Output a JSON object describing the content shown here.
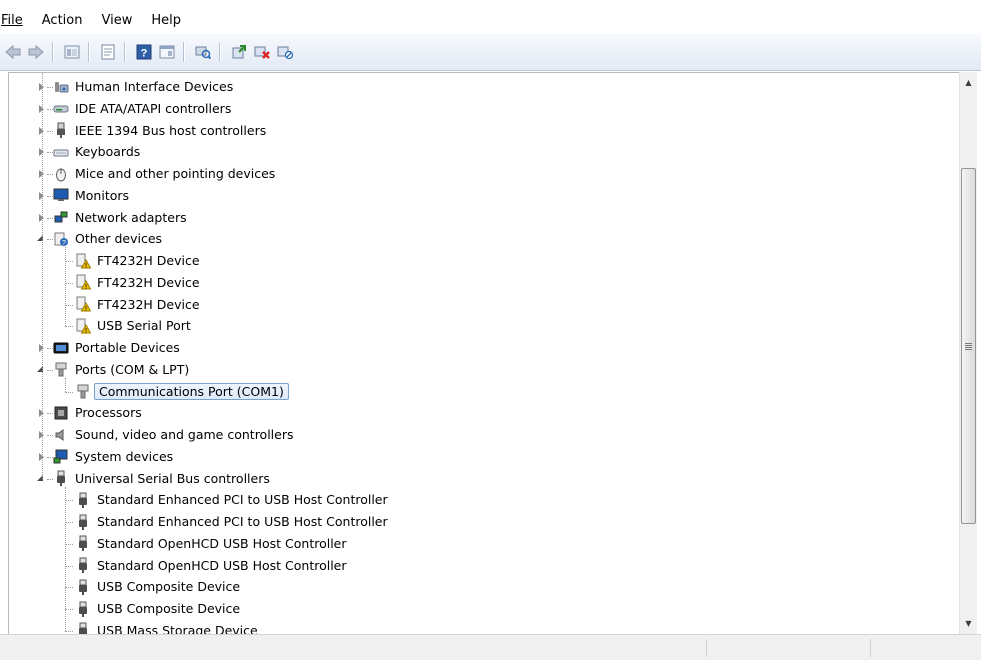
{
  "menu": [
    {
      "label": "File"
    },
    {
      "label": "Action"
    },
    {
      "label": "View"
    },
    {
      "label": "Help"
    }
  ],
  "toolbar": {
    "icons": [
      "back-icon",
      "forward-icon",
      "up-icon",
      "properties-icon",
      "help-icon",
      "show-hide-icon",
      "scan-icon",
      "update-driver-icon",
      "uninstall-icon",
      "disable-icon"
    ]
  },
  "tree": [
    {
      "label": "Human Interface Devices",
      "level": 0,
      "state": "closed",
      "icon": "hid-icon"
    },
    {
      "label": "IDE ATA/ATAPI controllers",
      "level": 0,
      "state": "closed",
      "icon": "ide-icon"
    },
    {
      "label": "IEEE 1394 Bus host controllers",
      "level": 0,
      "state": "closed",
      "icon": "firewire-icon"
    },
    {
      "label": "Keyboards",
      "level": 0,
      "state": "closed",
      "icon": "keyboard-icon"
    },
    {
      "label": "Mice and other pointing devices",
      "level": 0,
      "state": "closed",
      "icon": "mouse-icon"
    },
    {
      "label": "Monitors",
      "level": 0,
      "state": "closed",
      "icon": "monitor-icon"
    },
    {
      "label": "Network adapters",
      "level": 0,
      "state": "closed",
      "icon": "network-icon"
    },
    {
      "label": "Other devices",
      "level": 0,
      "state": "open",
      "icon": "unknown-device-icon"
    },
    {
      "label": "FT4232H Device",
      "level": 1,
      "icon": "warning-device-icon"
    },
    {
      "label": "FT4232H Device",
      "level": 1,
      "icon": "warning-device-icon"
    },
    {
      "label": "FT4232H Device",
      "level": 1,
      "icon": "warning-device-icon"
    },
    {
      "label": "USB Serial Port",
      "level": 1,
      "icon": "warning-device-icon"
    },
    {
      "label": "Portable Devices",
      "level": 0,
      "state": "closed",
      "icon": "portable-icon"
    },
    {
      "label": "Ports (COM & LPT)",
      "level": 0,
      "state": "open",
      "icon": "port-icon"
    },
    {
      "label": "Communications Port (COM1)",
      "level": 1,
      "icon": "port-icon",
      "selected": true
    },
    {
      "label": "Processors",
      "level": 0,
      "state": "closed",
      "icon": "processor-icon"
    },
    {
      "label": "Sound, video and game controllers",
      "level": 0,
      "state": "closed",
      "icon": "sound-icon"
    },
    {
      "label": "System devices",
      "level": 0,
      "state": "closed",
      "icon": "system-icon"
    },
    {
      "label": "Universal Serial Bus controllers",
      "level": 0,
      "state": "open",
      "icon": "usb-icon"
    },
    {
      "label": "Standard Enhanced PCI to USB Host Controller",
      "level": 1,
      "icon": "usb-icon"
    },
    {
      "label": "Standard Enhanced PCI to USB Host Controller",
      "level": 1,
      "icon": "usb-icon"
    },
    {
      "label": "Standard OpenHCD USB Host Controller",
      "level": 1,
      "icon": "usb-icon"
    },
    {
      "label": "Standard OpenHCD USB Host Controller",
      "level": 1,
      "icon": "usb-icon"
    },
    {
      "label": "USB Composite Device",
      "level": 1,
      "icon": "usb-icon"
    },
    {
      "label": "USB Composite Device",
      "level": 1,
      "icon": "usb-icon"
    },
    {
      "label": "USB Mass Storage Device",
      "level": 1,
      "icon": "usb-icon"
    }
  ],
  "scrollbar": {
    "position_fraction": 0.27,
    "visible_fraction": 0.64
  },
  "colors": {
    "accent": "#3c7fb1",
    "selection_border": "#7da2ce",
    "warning": "#e8b400"
  }
}
